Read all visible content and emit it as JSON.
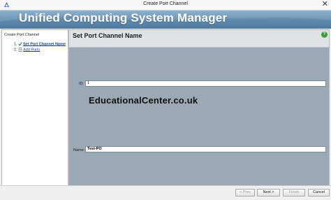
{
  "window": {
    "title": "Create Port Channel",
    "close_symbol": "✕"
  },
  "banner": {
    "title": "Unified Computing System Manager"
  },
  "sidebar": {
    "heading": "Create Port Channel",
    "steps": [
      {
        "number": "1.",
        "label": "Set Port Channel Name",
        "icon": "check-icon"
      },
      {
        "number": "2.",
        "label": "Add Ports",
        "icon": "document-icon"
      }
    ]
  },
  "main": {
    "section_title": "Set Port Channel Name",
    "help_symbol": "?",
    "fields": {
      "id": {
        "label": "ID:",
        "value": "1"
      },
      "name": {
        "label": "Name:",
        "value": "Test-PO"
      }
    },
    "watermark": "EducationalCenter.co.uk"
  },
  "footer": {
    "prev": "< Prev",
    "next": "Next >",
    "finish": "Finish",
    "cancel": "Cancel"
  }
}
